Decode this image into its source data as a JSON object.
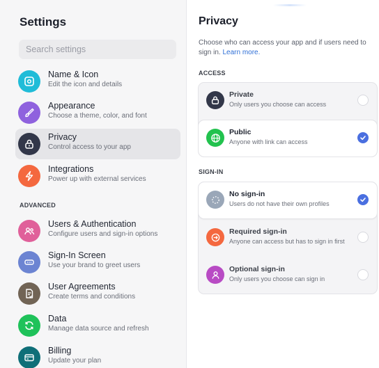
{
  "sidebar": {
    "title": "Settings",
    "search": {
      "placeholder": "Search settings"
    },
    "items": [
      {
        "label": "Name & Icon",
        "sub": "Edit the icon and details",
        "icon": "square-image-icon",
        "color": "#20bcd8"
      },
      {
        "label": "Appearance",
        "sub": "Choose a theme, color, and font",
        "icon": "brush-icon",
        "color": "#8f62de"
      },
      {
        "label": "Privacy",
        "sub": "Control access to your app",
        "icon": "lock-icon",
        "color": "#323749",
        "active": true
      },
      {
        "label": "Integrations",
        "sub": "Power up with external services",
        "icon": "lightning-icon",
        "color": "#f4683f"
      }
    ],
    "advanced_heading": "ADVANCED",
    "advanced": [
      {
        "label": "Users & Authentication",
        "sub": "Configure users and sign-in options",
        "icon": "users-icon",
        "color": "#e0609a"
      },
      {
        "label": "Sign-In Screen",
        "sub": "Use your brand to greet users",
        "icon": "password-field-icon",
        "color": "#6c84d2"
      },
      {
        "label": "User Agreements",
        "sub": "Create terms and conditions",
        "icon": "document-check-icon",
        "color": "#716455"
      },
      {
        "label": "Data",
        "sub": "Manage data source and refresh",
        "icon": "refresh-icon",
        "color": "#1fc25a"
      },
      {
        "label": "Billing",
        "sub": "Update your plan",
        "icon": "card-icon",
        "color": "#0f6f78"
      }
    ]
  },
  "main": {
    "title": "Privacy",
    "description": "Choose who can access your app and if users need to sign in.",
    "learn_more": "Learn more.",
    "access_heading": "ACCESS",
    "access": [
      {
        "label": "Private",
        "sub": "Only users you choose can access",
        "icon": "lock-icon",
        "color": "#323749",
        "selected": false
      },
      {
        "label": "Public",
        "sub": "Anyone with link can access",
        "icon": "globe-icon",
        "color": "#22c24e",
        "selected": true
      }
    ],
    "signin_heading": "SIGN-IN",
    "signin": [
      {
        "label": "No sign-in",
        "sub": "Users do not have their own profiles",
        "icon": "dashed-circle-icon",
        "color": "#9aa7b8",
        "selected": true
      },
      {
        "label": "Required sign-in",
        "sub": "Anyone can access but has to sign in first",
        "icon": "enter-icon",
        "color": "#f4683f",
        "selected": false
      },
      {
        "label": "Optional sign-in",
        "sub": "Only users you choose can sign in",
        "icon": "user-icon",
        "color": "#b84bc4",
        "selected": false
      }
    ],
    "accent_color": "#4a6fe0"
  }
}
